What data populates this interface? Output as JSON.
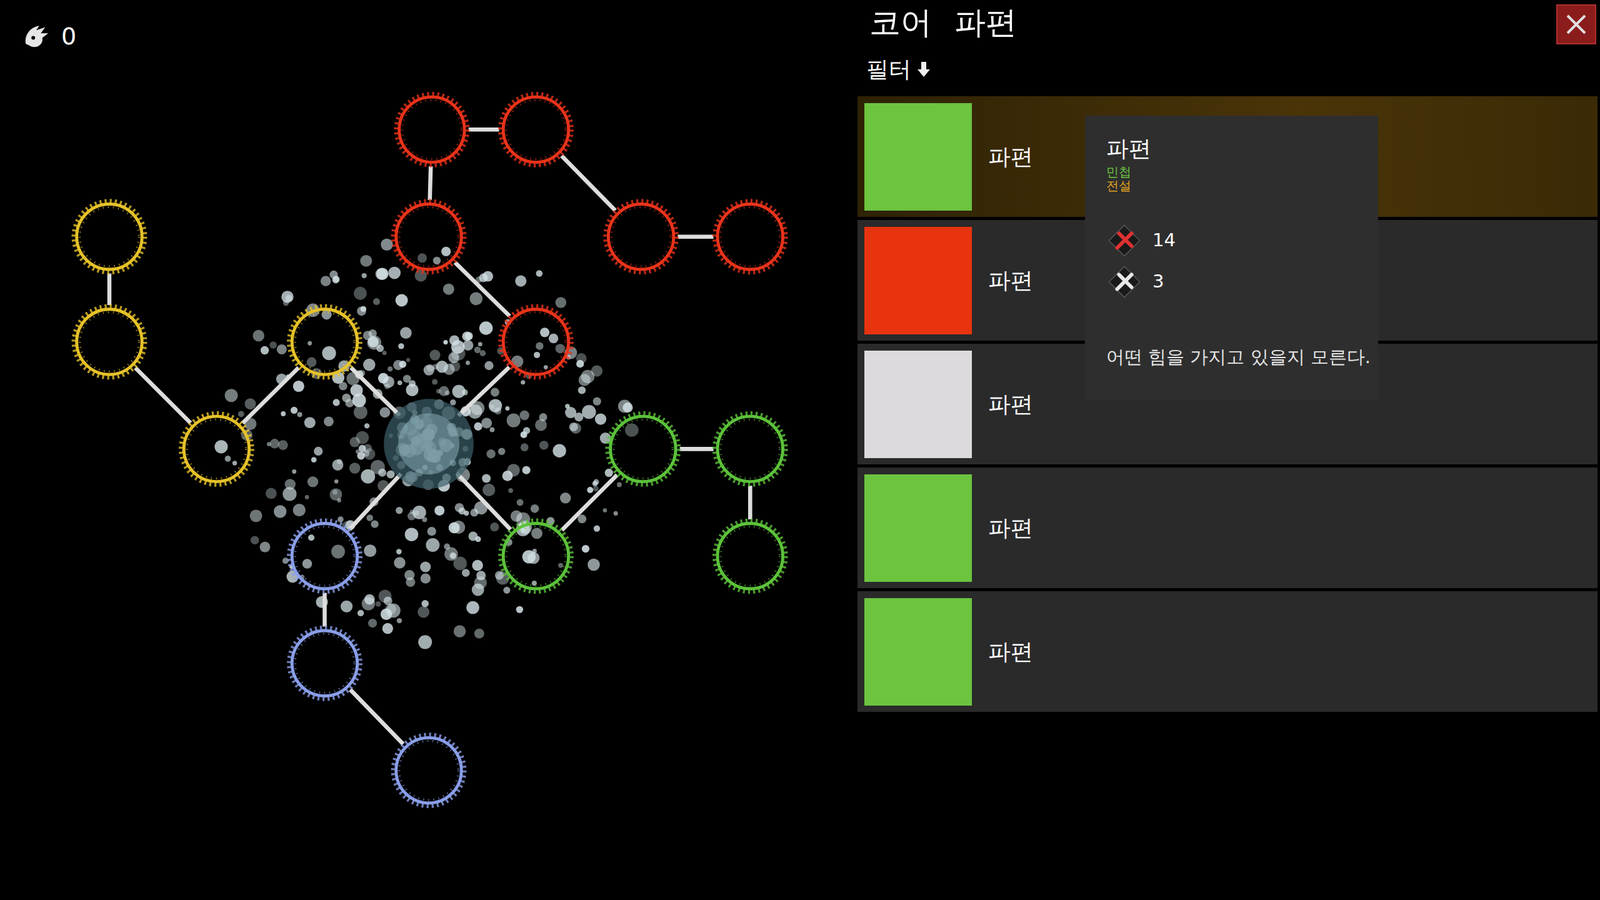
{
  "counter": {
    "value": "0"
  },
  "tree": {
    "branches": [
      {
        "color": "#e8331a",
        "nodes": 6
      },
      {
        "color": "#e6c229",
        "nodes": 4
      },
      {
        "color": "#5cc23a",
        "nodes": 4
      },
      {
        "color": "#8a9ee8",
        "nodes": 3
      }
    ]
  },
  "tabs": [
    {
      "label": "코어"
    },
    {
      "label": "파편"
    }
  ],
  "filter": {
    "label": "필터"
  },
  "items": [
    {
      "label": "파편",
      "color": "#6cc43f",
      "selected": true
    },
    {
      "label": "파편",
      "color": "#e8330f",
      "selected": false
    },
    {
      "label": "파편",
      "color": "#dcdadc",
      "selected": false
    },
    {
      "label": "파편",
      "color": "#6cc43f",
      "selected": false
    },
    {
      "label": "파편",
      "color": "#6cc43f",
      "selected": false
    }
  ],
  "tooltip": {
    "title": "파편",
    "tags": [
      {
        "label": "민첩",
        "color": "#6cc43f"
      },
      {
        "label": "전설",
        "color": "#e0a020"
      }
    ],
    "stats": [
      {
        "value": "14",
        "color": "#e03030"
      },
      {
        "value": "3",
        "color": "#e8e8e8"
      }
    ],
    "description": "어떤 힘을 가지고 있을지 모른다."
  }
}
